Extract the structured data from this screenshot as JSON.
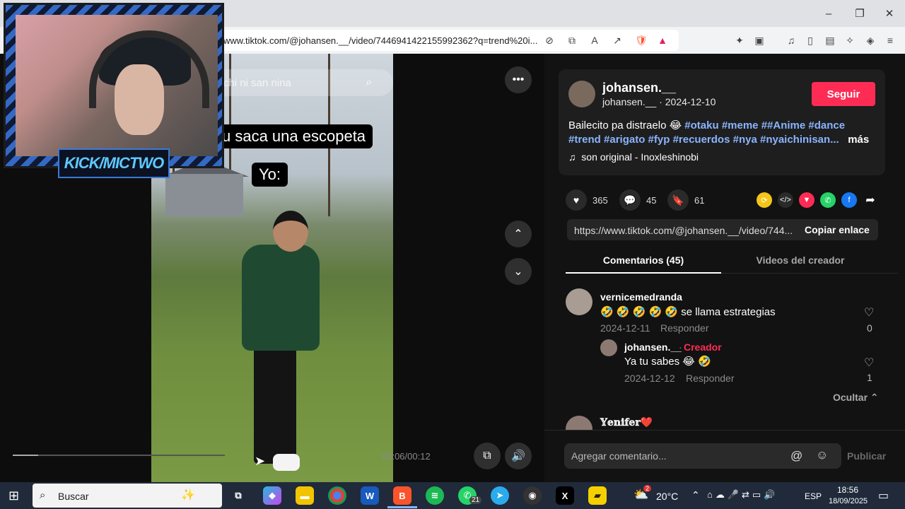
{
  "browser": {
    "url": "www.tiktok.com/@johansen.__/video/7446941422155992362?q=trend%20i...",
    "shield_badge": "5",
    "window_controls": {
      "minimize": "–",
      "maximize": "❐",
      "close": "✕"
    }
  },
  "video": {
    "search_placeholder": "chi ni san nina",
    "caption_line1": "u saca una escopeta",
    "caption_line2": "Yo:",
    "timecode": "00:06/00:12",
    "progress": 0.12
  },
  "stream_overlay": {
    "banner": "KICK/MICTWO"
  },
  "post": {
    "username": "johansen.__",
    "handle": "johansen.__",
    "date": "2024-12-10",
    "follow_label": "Seguir",
    "desc_text": "Bailecito pa distraelo 😂 ",
    "tags": [
      "#otaku",
      "#meme",
      "##Anime",
      "#dance",
      "#trend",
      "#arigato",
      "#fyp",
      "#recuerdos",
      "#nya",
      "#nyaichinisan..."
    ],
    "more_label": "más",
    "sound": "son original - Inoxleshinobi",
    "likes": "365",
    "comments": "45",
    "saves": "61",
    "link_url": "https://www.tiktok.com/@johansen.__/video/744...",
    "copy_link_label": "Copiar enlace"
  },
  "tabs": {
    "comments": "Comentarios (45)",
    "creator_videos": "Videos del creador"
  },
  "comments": [
    {
      "user": "vernicemedranda",
      "text": "🤣 🤣 🤣 🤣 🤣 se llama estrategias",
      "date": "2024-12-11",
      "reply_label": "Responder",
      "likes": "0"
    },
    {
      "user": "johansen.__",
      "creator_label": "Creador",
      "text": "Ya tu sabes 😂 🤣",
      "date": "2024-12-12",
      "reply_label": "Responder",
      "likes": "1"
    },
    {
      "user": "𝕐𝕖𝕟𝕚𝕗𝕖𝕣❤️"
    }
  ],
  "hide_label": "Ocultar",
  "comment_bar": {
    "placeholder": "Agregar comentario...",
    "publish_label": "Publicar"
  },
  "taskbar": {
    "search_label": "Buscar",
    "weather": "20°C",
    "language": "ESP",
    "time": "18:56",
    "date": "18/09/2025",
    "whatsapp_badge": "21",
    "weather_badge": "2"
  },
  "colors": {
    "accent": "#fe2c55",
    "hashtag": "#8ab4ff",
    "panel_bg": "#121212"
  }
}
